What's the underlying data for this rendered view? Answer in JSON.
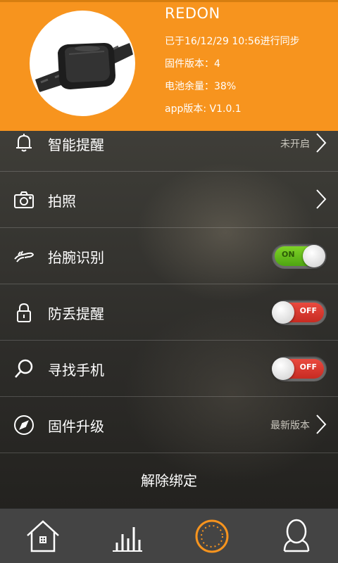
{
  "device": {
    "name": "REDON",
    "sync_text": "已于16/12/29 10:56进行同步",
    "firmware_text": "固件版本：4",
    "battery_text": "电池余量：38%",
    "app_version_text": "app版本: V1.0.1"
  },
  "menu": {
    "reminder": {
      "label": "智能提醒",
      "status": "未开启",
      "icon": "bell-icon"
    },
    "camera": {
      "label": "拍照",
      "icon": "camera-icon"
    },
    "wrist": {
      "label": "抬腕识别",
      "toggle_text": "ON",
      "enabled": true,
      "icon": "wrist-icon"
    },
    "anti_lost": {
      "label": "防丢提醒",
      "toggle_text": "OFF",
      "enabled": false,
      "icon": "lock-icon"
    },
    "find_phone": {
      "label": "寻找手机",
      "toggle_text": "OFF",
      "enabled": false,
      "icon": "search-icon"
    },
    "firmware_upgrade": {
      "label": "固件升级",
      "status": "最新版本",
      "icon": "compass-icon"
    }
  },
  "unbind_label": "解除绑定",
  "tabs": [
    {
      "icon": "home-icon",
      "active": false
    },
    {
      "icon": "bar-chart-icon",
      "active": false
    },
    {
      "icon": "device-ring-icon",
      "active": true
    },
    {
      "icon": "profile-icon",
      "active": false
    }
  ],
  "colors": {
    "accent": "#f7941e",
    "toggle_on": "#6cc21d",
    "toggle_off": "#e0392f",
    "tabbar": "#444444"
  }
}
